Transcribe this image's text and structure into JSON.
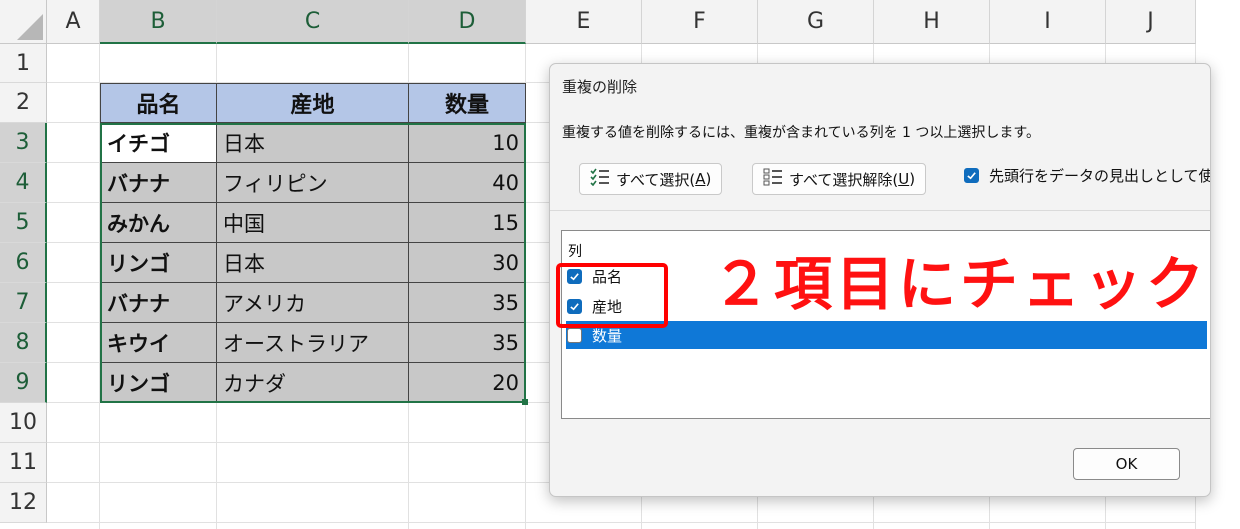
{
  "sheet": {
    "columns": [
      "A",
      "B",
      "C",
      "D",
      "E",
      "F",
      "G",
      "H",
      "I",
      "J"
    ],
    "rows": [
      "1",
      "2",
      "3",
      "4",
      "5",
      "6",
      "7",
      "8",
      "9",
      "10",
      "11",
      "12"
    ],
    "table": {
      "headers": [
        "品名",
        "産地",
        "数量"
      ],
      "rows": [
        [
          "イチゴ",
          "日本",
          "10"
        ],
        [
          "バナナ",
          "フィリピン",
          "40"
        ],
        [
          "みかん",
          "中国",
          "15"
        ],
        [
          "リンゴ",
          "日本",
          "30"
        ],
        [
          "バナナ",
          "アメリカ",
          "35"
        ],
        [
          "キウイ",
          "オーストラリア",
          "35"
        ],
        [
          "リンゴ",
          "カナダ",
          "20"
        ]
      ]
    }
  },
  "dialog": {
    "title": "重複の削除",
    "description": "重複する値を削除するには、重複が含まれている列を 1 つ以上選択します。",
    "select_all": {
      "prefix": "すべて選択(",
      "key": "A",
      "suffix": ")"
    },
    "unselect_all": {
      "prefix": "すべて選択解除(",
      "key": "U",
      "suffix": ")"
    },
    "header_checkbox_label": "先頭行をデータの見出しとして使",
    "header_checkbox_checked": true,
    "columns_label": "列",
    "columns": [
      {
        "label": "品名",
        "checked": true
      },
      {
        "label": "産地",
        "checked": true
      },
      {
        "label": "数量",
        "checked": false
      }
    ],
    "ok_label": "OK"
  },
  "annotation": {
    "text": "２項目にチェック",
    "color": "#ff0000"
  },
  "colors": {
    "header_fill": "#b4c6e7",
    "selection_fill": "#c8c8c8",
    "excel_green": "#217346",
    "check_blue": "#0f6cbd",
    "highlight_blue": "#0f78d7"
  }
}
